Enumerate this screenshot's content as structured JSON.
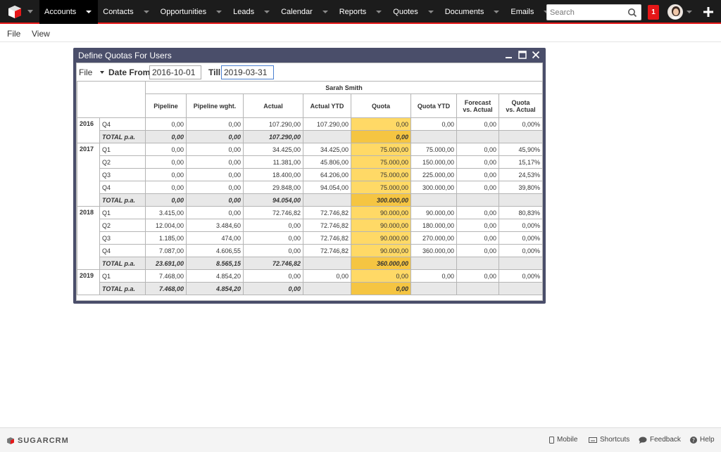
{
  "nav": {
    "items": [
      {
        "label": "Accounts",
        "active": true
      },
      {
        "label": "Contacts",
        "active": false
      },
      {
        "label": "Opportunities",
        "active": false
      },
      {
        "label": "Leads",
        "active": false
      },
      {
        "label": "Calendar",
        "active": false
      },
      {
        "label": "Reports",
        "active": false
      },
      {
        "label": "Quotes",
        "active": false
      },
      {
        "label": "Documents",
        "active": false
      },
      {
        "label": "Emails",
        "active": false
      }
    ],
    "search_placeholder": "Search",
    "notification_count": "1",
    "accent": "#e61718"
  },
  "menubar": {
    "file": "File",
    "view": "View"
  },
  "dialog": {
    "title": "Define Quotas For Users",
    "file_menu": "File",
    "date_from_label": "Date From",
    "date_from_value": "2016-10-01",
    "till_label": "Till",
    "till_value": "2019-03-31"
  },
  "table": {
    "user": "Sarah Smith",
    "headers": [
      "Pipeline",
      "Pipeline wght.",
      "Actual",
      "Actual YTD",
      "Quota",
      "Quota YTD",
      "Forecast vs. Actual",
      "Quota vs. Actual"
    ],
    "header_lines": [
      [
        "Pipeline"
      ],
      [
        "Pipeline wght."
      ],
      [
        "Actual"
      ],
      [
        "Actual YTD"
      ],
      [
        "Quota"
      ],
      [
        "Quota YTD"
      ],
      [
        "Forecast",
        "vs. Actual"
      ],
      [
        "Quota",
        "vs. Actual"
      ]
    ],
    "years": [
      {
        "year": "2016",
        "rows": [
          {
            "period": "Q4",
            "cells": [
              "0,00",
              "0,00",
              "107.290,00",
              "107.290,00",
              "0,00",
              "0,00",
              "0,00",
              "0,00%"
            ]
          },
          {
            "period": "TOTAL p.a.",
            "total": true,
            "cells": [
              "0,00",
              "0,00",
              "107.290,00",
              "",
              "0,00",
              "",
              "",
              ""
            ]
          }
        ]
      },
      {
        "year": "2017",
        "rows": [
          {
            "period": "Q1",
            "cells": [
              "0,00",
              "0,00",
              "34.425,00",
              "34.425,00",
              "75.000,00",
              "75.000,00",
              "0,00",
              "45,90%"
            ]
          },
          {
            "period": "Q2",
            "cells": [
              "0,00",
              "0,00",
              "11.381,00",
              "45.806,00",
              "75.000,00",
              "150.000,00",
              "0,00",
              "15,17%"
            ]
          },
          {
            "period": "Q3",
            "cells": [
              "0,00",
              "0,00",
              "18.400,00",
              "64.206,00",
              "75.000,00",
              "225.000,00",
              "0,00",
              "24,53%"
            ]
          },
          {
            "period": "Q4",
            "cells": [
              "0,00",
              "0,00",
              "29.848,00",
              "94.054,00",
              "75.000,00",
              "300.000,00",
              "0,00",
              "39,80%"
            ]
          },
          {
            "period": "TOTAL p.a.",
            "total": true,
            "cells": [
              "0,00",
              "0,00",
              "94.054,00",
              "",
              "300.000,00",
              "",
              "",
              ""
            ]
          }
        ]
      },
      {
        "year": "2018",
        "rows": [
          {
            "period": "Q1",
            "cells": [
              "3.415,00",
              "0,00",
              "72.746,82",
              "72.746,82",
              "90.000,00",
              "90.000,00",
              "0,00",
              "80,83%"
            ]
          },
          {
            "period": "Q2",
            "cells": [
              "12.004,00",
              "3.484,60",
              "0,00",
              "72.746,82",
              "90.000,00",
              "180.000,00",
              "0,00",
              "0,00%"
            ]
          },
          {
            "period": "Q3",
            "cells": [
              "1.185,00",
              "474,00",
              "0,00",
              "72.746,82",
              "90.000,00",
              "270.000,00",
              "0,00",
              "0,00%"
            ]
          },
          {
            "period": "Q4",
            "cells": [
              "7.087,00",
              "4.606,55",
              "0,00",
              "72.746,82",
              "90.000,00",
              "360.000,00",
              "0,00",
              "0,00%"
            ]
          },
          {
            "period": "TOTAL p.a.",
            "total": true,
            "cells": [
              "23.691,00",
              "8.565,15",
              "72.746,82",
              "",
              "360.000,00",
              "",
              "",
              ""
            ]
          }
        ]
      },
      {
        "year": "2019",
        "rows": [
          {
            "period": "Q1",
            "cells": [
              "7.468,00",
              "4.854,20",
              "0,00",
              "0,00",
              "0,00",
              "0,00",
              "0,00",
              "0,00%"
            ]
          },
          {
            "period": "TOTAL p.a.",
            "total": true,
            "cells": [
              "7.468,00",
              "4.854,20",
              "0,00",
              "",
              "0,00",
              "",
              "",
              ""
            ]
          }
        ]
      }
    ],
    "quota_color": "#ffd966",
    "quota_total_color": "#f5c542"
  },
  "footer": {
    "brand": "SUGARCRM",
    "links": [
      "Mobile",
      "Shortcuts",
      "Feedback",
      "Help"
    ]
  }
}
